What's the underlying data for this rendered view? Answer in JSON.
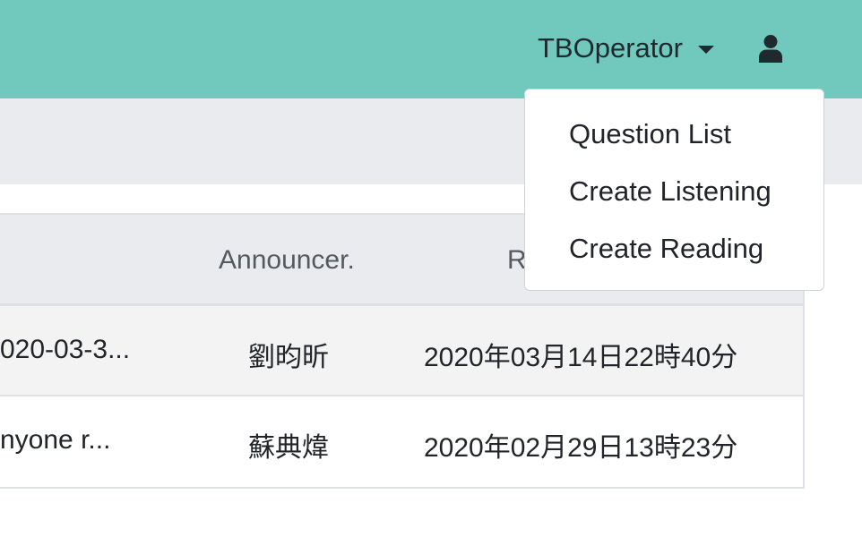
{
  "navbar": {
    "user_label": "TBOperator",
    "user_icon": "user-icon",
    "caret_icon": "caret-down-icon",
    "bg_color": "#71c8bc"
  },
  "dropdown": {
    "items": [
      {
        "label": "Question List"
      },
      {
        "label": "Create Listening"
      },
      {
        "label": "Create Reading"
      }
    ]
  },
  "table": {
    "headers": [
      "Announcer.",
      "R"
    ],
    "rows": [
      {
        "title_fragment": "020-03-3...",
        "announcer": "劉昀昕",
        "date": "2020年03月14日22時40分"
      },
      {
        "title_fragment": "nyone r...",
        "announcer": "蘇典煒",
        "date": "2020年02月29日13時23分"
      }
    ]
  }
}
